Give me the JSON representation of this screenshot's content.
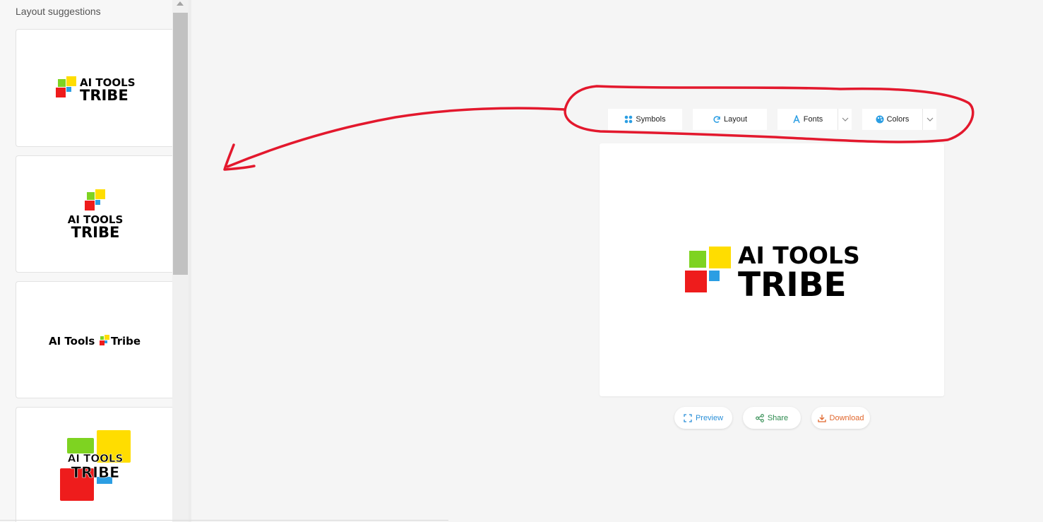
{
  "sidebar": {
    "title": "Layout suggestions",
    "cards": [
      {
        "line1": "AI TOOLS",
        "line2": "TRIBE",
        "layout": "icon-left"
      },
      {
        "line1": "AI TOOLS",
        "line2": "TRIBE",
        "layout": "icon-top"
      },
      {
        "text_left": "AI Tools",
        "text_right": "Tribe",
        "layout": "inline"
      },
      {
        "line1": "AI TOOLS",
        "line2": "TRIBE",
        "layout": "icon-behind"
      }
    ]
  },
  "toolbar": {
    "symbols": {
      "label": "Symbols",
      "icon": "grid-dots-icon"
    },
    "layout": {
      "label": "Layout",
      "icon": "refresh-icon"
    },
    "fonts": {
      "label": "Fonts",
      "icon": "letter-a-icon"
    },
    "colors": {
      "label": "Colors",
      "icon": "palette-icon"
    }
  },
  "canvas": {
    "logo_line1": "AI TOOLS",
    "logo_line2": "TRIBE"
  },
  "actions": {
    "preview": {
      "label": "Preview",
      "color": "#2a8fd8",
      "icon": "expand-icon"
    },
    "share": {
      "label": "Share",
      "color": "#2d8a4e",
      "icon": "share-icon"
    },
    "download": {
      "label": "Download",
      "color": "#e0662c",
      "icon": "download-icon"
    }
  },
  "colors": {
    "logo_red": "#ee1c1c",
    "logo_green": "#7ed321",
    "logo_yellow": "#ffdd00",
    "logo_blue": "#2b9ee3",
    "annotation_red": "#e3182d"
  }
}
